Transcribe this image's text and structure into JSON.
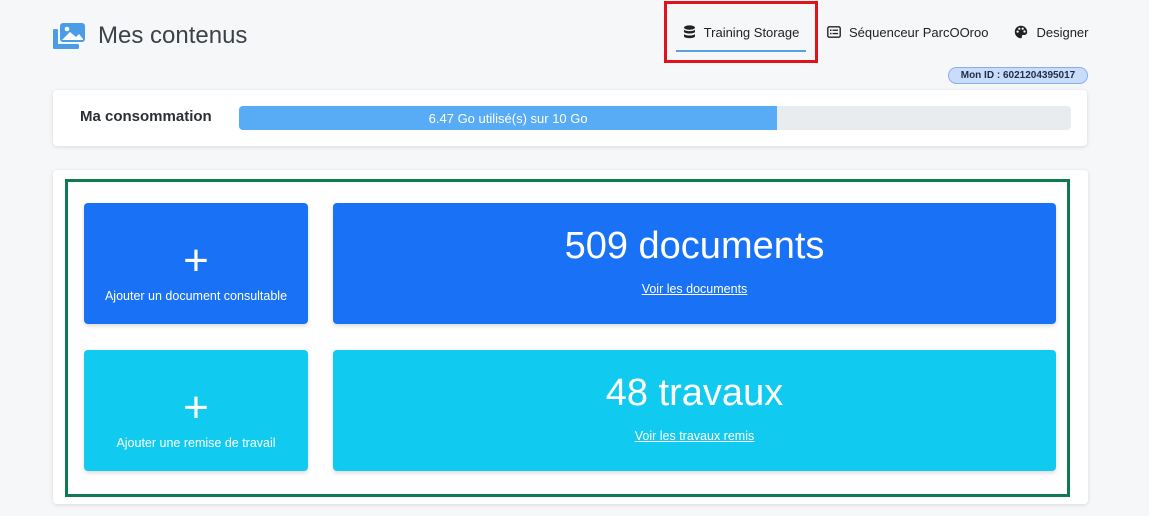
{
  "header": {
    "title": "Mes contenus",
    "logo_icon": "images-icon"
  },
  "nav": {
    "items": [
      {
        "label": "Training Storage",
        "icon": "database-icon",
        "active": true
      },
      {
        "label": "Séquenceur ParcOOroo",
        "icon": "card-list-icon"
      },
      {
        "label": "Designer",
        "icon": "palette-icon"
      }
    ]
  },
  "user": {
    "id_badge": "Mon ID : 6021204395017"
  },
  "consumption": {
    "label": "Ma consommation",
    "progress_text": "6.47 Go utilisé(s) sur 10 Go",
    "used_gb": 6.47,
    "total_gb": 10
  },
  "tiles": {
    "add_document": {
      "plus": "+",
      "label": "Ajouter un document consultable"
    },
    "documents": {
      "count": "509 documents",
      "link": "Voir les documents"
    },
    "add_work": {
      "plus": "+",
      "label": "Ajouter une remise de travail"
    },
    "works": {
      "count": "48 travaux",
      "link": "Voir les travaux remis"
    }
  },
  "colors": {
    "primary_blue": "#1971f6",
    "cyan": "#10cbef",
    "progress": "#57acf5",
    "highlight_red": "#e0121b",
    "highlight_green": "#0f7a4f"
  }
}
